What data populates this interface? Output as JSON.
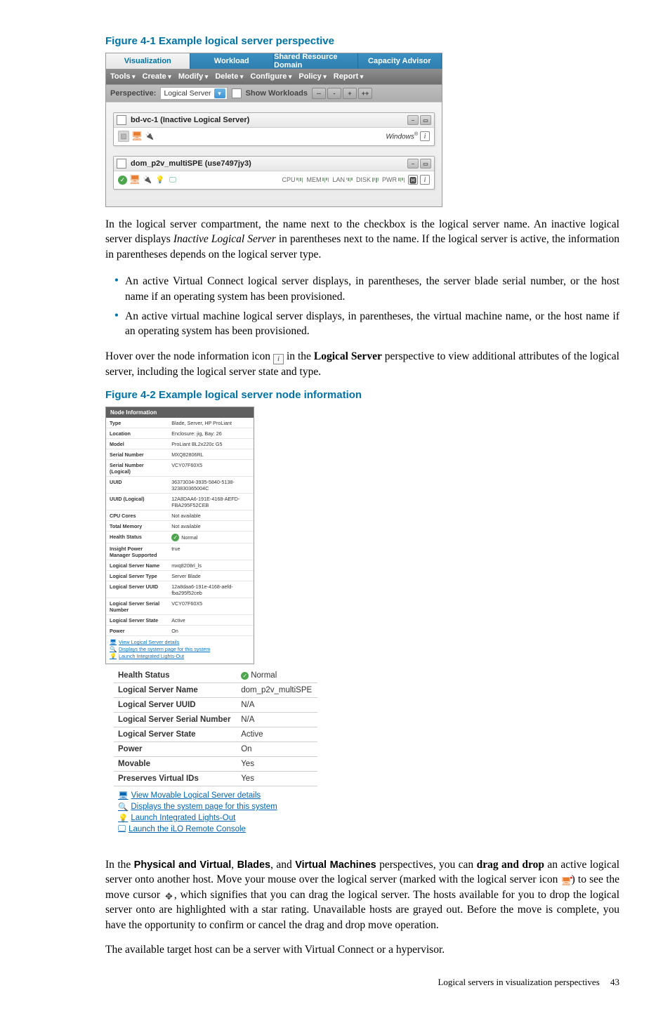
{
  "fig41": {
    "title": "Figure 4-1 Example logical server perspective",
    "tabs": [
      "Visualization",
      "Workload",
      "Shared Resource Domain",
      "Capacity Advisor"
    ],
    "toolbar": [
      "Tools",
      "Create",
      "Modify",
      "Delete",
      "Configure",
      "Policy",
      "Report"
    ],
    "perspective_label": "Perspective:",
    "perspective_value": "Logical Server",
    "show_workloads": "Show Workloads",
    "card1": {
      "title": "bd-vc-1 (Inactive Logical Server)",
      "os": "Windows"
    },
    "card2": {
      "title": "dom_p2v_multiSPE (use7497jy3)",
      "meters": [
        "CPU",
        "MEM",
        "LAN",
        "DISK",
        "PWR"
      ]
    }
  },
  "para1_a": "In the logical server compartment, the name next to the checkbox is the logical server name. An inactive logical server displays ",
  "para1_i": "Inactive Logical Server",
  "para1_b": " in parentheses next to the name. If the logical server is active, the information in parentheses depends on the logical server type.",
  "bullet1": "An active Virtual Connect logical server displays, in parentheses, the server blade serial number, or the host name if an operating system has been provisioned.",
  "bullet2": "An active virtual machine logical server displays, in parentheses, the virtual machine name, or the host name if an operating system has been provisioned.",
  "para2_a": "Hover over the node information icon ",
  "para2_b": " in the ",
  "para2_bold": "Logical Server",
  "para2_c": " perspective to view additional attributes of the logical server, including the logical server state and type.",
  "fig42": {
    "title": "Figure 4-2 Example logical server node information",
    "small": {
      "header": "Node Information",
      "rows": [
        [
          "Type",
          "Blade, Server, HP ProLiant"
        ],
        [
          "Location",
          "Enclosure: jig, Bay: 26"
        ],
        [
          "Model",
          "ProLiant BL2x220c G5"
        ],
        [
          "Serial Number",
          "MXQ82806RL"
        ],
        [
          "Serial Number (Logical)",
          "VCY07F60X5"
        ],
        [
          "UUID",
          "36373034-3935-5840-5138-323830365004C"
        ],
        [
          "UUID (Logical)",
          "12A8DAA6-191E-4168-AEFD-FBA295F52CEB"
        ],
        [
          "CPU Cores",
          "Not available"
        ],
        [
          "Total Memory",
          "Not available"
        ],
        [
          "Health Status",
          "Normal"
        ],
        [
          "Insight Power Manager Supported",
          "true"
        ],
        [
          "Logical Server Name",
          "mxq8208rl_ls"
        ],
        [
          "Logical Server Type",
          "Server Blade"
        ],
        [
          "Logical Server UUID",
          "12a8daa6-191e-4168-aefd-fba295f52ceb"
        ],
        [
          "Logical Server Serial Number",
          "VCY07F60X5"
        ],
        [
          "Logical Server State",
          "Active"
        ],
        [
          "Power",
          "On"
        ]
      ],
      "links": [
        "View Logical Server details",
        "Displays the system page for this system",
        "Launch Integrated Lights-Out"
      ]
    },
    "big": {
      "rows": [
        [
          "Health Status",
          "Normal"
        ],
        [
          "Logical Server Name",
          "dom_p2v_multiSPE"
        ],
        [
          "Logical Server UUID",
          "N/A"
        ],
        [
          "Logical Server Serial Number",
          "N/A"
        ],
        [
          "Logical Server State",
          "Active"
        ],
        [
          "Power",
          "On"
        ],
        [
          "Movable",
          "Yes"
        ],
        [
          "Preserves Virtual IDs",
          "Yes"
        ]
      ],
      "links": [
        "View Movable Logical Server details",
        "Displays the system page for this system",
        "Launch Integrated Lights-Out",
        "Launch the iLO Remote Console"
      ]
    }
  },
  "para3_a": "In the ",
  "para3_b1": "Physical and Virtual",
  "para3_c": ", ",
  "para3_b2": "Blades",
  "para3_d": ", and ",
  "para3_b3": "Virtual Machines",
  "para3_e": " perspectives, you can ",
  "para3_b4": "drag and drop",
  "para3_f": " an active logical server onto another host. Move your mouse over the logical server (marked with the logical server icon ",
  "para3_g": ") to see the move cursor ",
  "para3_h": ", which signifies that you can drag the logical server. The hosts available for you to drop the logical server onto are highlighted with a star rating. Unavailable hosts are grayed out. Before the move is complete, you have the opportunity to confirm or cancel the drag and drop move operation.",
  "para4": "The available target host can be a server with Virtual Connect or a hypervisor.",
  "footer_section": "Logical servers in visualization perspectives",
  "footer_page": "43"
}
